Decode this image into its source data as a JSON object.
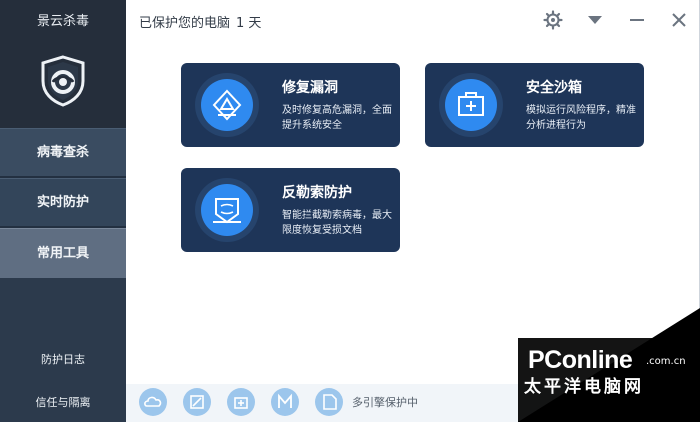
{
  "app": {
    "title": "景云杀毒"
  },
  "sidebar": {
    "items": [
      {
        "label": "病毒查杀",
        "selected": false
      },
      {
        "label": "实时防护",
        "selected": false
      },
      {
        "label": "常用工具",
        "selected": true
      }
    ],
    "bottom": [
      {
        "label": "防护日志"
      },
      {
        "label": "信任与隔离"
      }
    ]
  },
  "header": {
    "status_text": "已保护您的电脑",
    "days": "1 天",
    "icons": [
      "settings-gear-icon",
      "dropdown-icon",
      "minimize-icon",
      "close-icon"
    ]
  },
  "tools": [
    {
      "title": "修复漏洞",
      "desc": "及时修复高危漏洞，全面提升系统安全",
      "icon": "shield-triangle-icon"
    },
    {
      "title": "安全沙箱",
      "desc": "模拟运行风险程序，精准分析进程行为",
      "icon": "sandbox-box-icon"
    },
    {
      "title": "反勒索防护",
      "desc": "智能拦截勒索病毒，最大限度恢复受损文档",
      "icon": "ransomware-shield-icon"
    }
  ],
  "bottom_bar": {
    "icons": [
      "cloud-engine-icon",
      "scan-engine-icon",
      "medical-engine-icon",
      "m-engine-icon",
      "file-engine-icon"
    ],
    "engine_text": "多引擎保护中"
  },
  "watermark": {
    "brand": "PConline",
    "domain": ".com.cn",
    "cn": "太平洋电脑网"
  },
  "colors": {
    "sidebar": "#2c3a4c",
    "card": "#1e3558",
    "accent": "#2f8af0",
    "engine_icon": "#9cc6ec"
  }
}
